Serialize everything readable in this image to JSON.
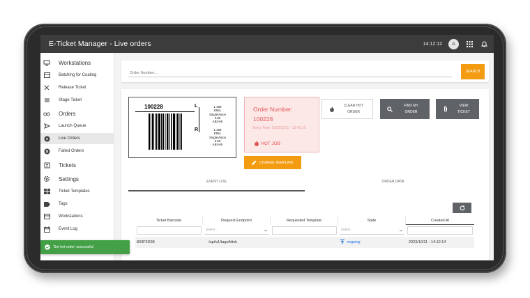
{
  "app": {
    "title": "E-Ticket Manager  - Live orders",
    "clock": "14:12:12",
    "avatar_initial": "A"
  },
  "sidebar": {
    "sections": [
      {
        "heading": "Workstations",
        "items": [
          "Batching for Coating",
          "Release Ticket",
          "Stage Ticket"
        ]
      },
      {
        "heading": "Orders",
        "items": [
          "Launch Queue",
          "Live Orders",
          "Failed Orders"
        ]
      },
      {
        "heading": "Tickets",
        "items": []
      },
      {
        "heading": "Settings",
        "items": [
          "Ticket Templates",
          "Tags",
          "Workstations",
          "Event Log"
        ]
      }
    ],
    "active_item": "Live Orders"
  },
  "toast": {
    "message": "'Set hot order' successful.",
    "color": "#43a047"
  },
  "search": {
    "placeholder": "Order Number...",
    "button_label": "SEARCH"
  },
  "ticket_label": {
    "order_number": "100228",
    "left_eye": "L",
    "right_eye": "R",
    "left_rx": [
      "1.498",
      "E55L",
      "SingleVision",
      "2.50",
      "AB3-65"
    ],
    "right_rx": [
      "1.496",
      "E55L",
      "SingleVision",
      "2.50",
      "AB3-65"
    ]
  },
  "order_info": {
    "title": "Order Number:",
    "number": "100228",
    "entry_time": "Entry Time: 2023/10/11 - 13:42:16",
    "hot_label": "HOT JOB",
    "accent_color": "#e05555"
  },
  "actions": {
    "clear_hot": "CLEAR HOT ORDER",
    "find_order": "FIND MY ORDER",
    "view_ticket": "VIEW TICKET",
    "change_template": "CHANGE TEMPLATE"
  },
  "tabs": [
    "EVENT LOG",
    "ORDER DATA"
  ],
  "table": {
    "columns": [
      "Ticket Barcode",
      "Request Endpoint",
      "Requested Template",
      "State",
      "Created At"
    ],
    "select_placeholder": "Select...",
    "rows": [
      {
        "barcode": "803F9D38",
        "endpoint": "/api/v1/tags/blink",
        "template": "",
        "state": "ongoing",
        "created": "2023/10/11 - 14:12:14"
      }
    ]
  },
  "colors": {
    "accent": "#f39c12",
    "header": "#3c3c3c",
    "dark_button": "#5f6368",
    "state_blue": "#1a73e8"
  }
}
